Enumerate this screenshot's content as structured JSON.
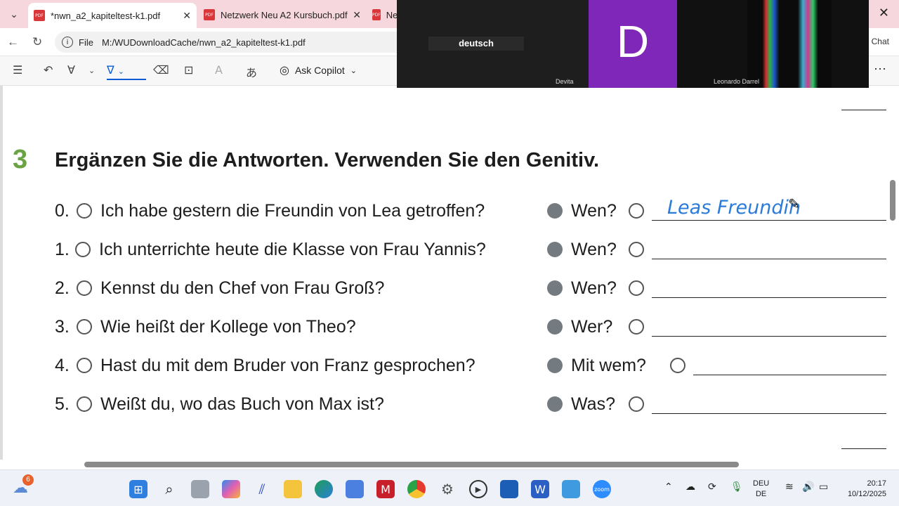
{
  "tabs": [
    {
      "label": "*nwn_a2_kapiteltest-k1.pdf",
      "active": true
    },
    {
      "label": "Netzwerk Neu A2 Kursbuch.pdf",
      "active": false
    },
    {
      "label": "Ne",
      "active": false
    }
  ],
  "address": {
    "prefix": "File",
    "url": "M:/WUDownloadCache/nwn_a2_kapiteltest-k1.pdf"
  },
  "side_chat": "Chat",
  "toolbar": {
    "copilot_label": "Ask Copilot"
  },
  "zoom": {
    "tile1_label": "deutsch",
    "tile1_name": "Devita",
    "tile2_letter": "D",
    "tile3_name": "Leonardo Darrel"
  },
  "exercise": {
    "number": "3",
    "title": "Ergänzen Sie die Antworten. Verwenden Sie den Genitiv.",
    "rows": [
      {
        "num": "0.",
        "question": "Ich habe gestern die Freundin von Lea getroffen?",
        "prompt": "Wen?",
        "answer": "Leas Freundin"
      },
      {
        "num": "1.",
        "question": "Ich unterrichte heute die Klasse von Frau Yannis?",
        "prompt": "Wen?",
        "answer": ""
      },
      {
        "num": "2.",
        "question": "Kennst du den Chef von Frau Groß?",
        "prompt": "Wen?",
        "answer": ""
      },
      {
        "num": "3.",
        "question": "Wie heißt der Kollege von Theo?",
        "prompt": "Wer?",
        "answer": ""
      },
      {
        "num": "4.",
        "question": "Hast du mit dem Bruder von Franz gesprochen?",
        "prompt": "Mit wem?",
        "answer": ""
      },
      {
        "num": "5.",
        "question": "Weißt du, wo das Buch von Max ist?",
        "prompt": "Was?",
        "answer": ""
      }
    ]
  },
  "taskbar": {
    "weather_badge": "6",
    "lang_top": "DEU",
    "lang_bottom": "DE",
    "time": "20:17",
    "date": "10/12/2025"
  }
}
